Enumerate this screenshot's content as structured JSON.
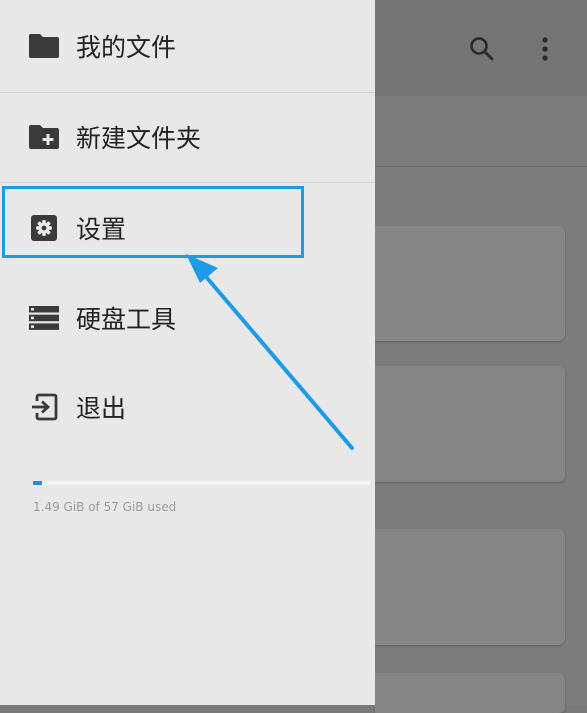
{
  "drawer": {
    "items": [
      {
        "label": "我的文件",
        "icon": "folder-icon"
      },
      {
        "label": "新建文件夹",
        "icon": "new-folder-icon"
      },
      {
        "label": "设置",
        "icon": "gear-icon"
      },
      {
        "label": "硬盘工具",
        "icon": "storage-icon"
      },
      {
        "label": "退出",
        "icon": "exit-icon"
      }
    ],
    "storage": {
      "text": "1.49 GiB of 57 GiB used",
      "used_fraction": 0.026
    }
  },
  "colors": {
    "accent": "#1a8fe3",
    "annotation": "#1e9be8",
    "drawer_bg": "#e8e8e8",
    "icon": "#3a3a3a"
  }
}
